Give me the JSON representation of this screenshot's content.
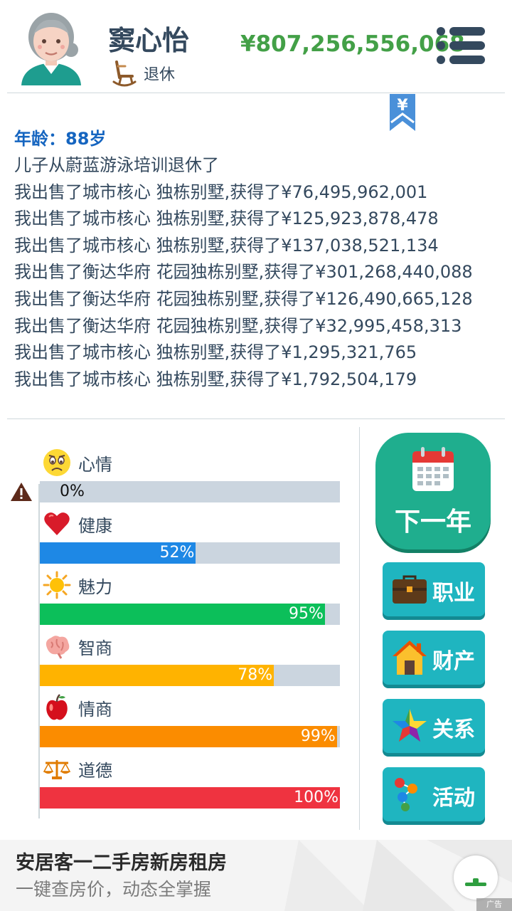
{
  "header": {
    "player_name": "窦心怡",
    "status": "退休",
    "money": "¥807,256,556,068"
  },
  "bookmark": {
    "symbol": "¥"
  },
  "log": {
    "age": "年龄：88岁",
    "lines": [
      "儿子从蔚蓝游泳培训退休了",
      "我出售了城市核心 独栋别墅,获得了¥76,495,962,001",
      "我出售了城市核心 独栋别墅,获得了¥125,923,878,478",
      "我出售了城市核心 独栋别墅,获得了¥137,038,521,134",
      "我出售了衡达华府 花园独栋别墅,获得了¥301,268,440,088",
      "我出售了衡达华府 花园独栋别墅,获得了¥126,490,665,128",
      "我出售了衡达华府 花园独栋别墅,获得了¥32,995,458,313",
      "我出售了城市核心 独栋别墅,获得了¥1,295,321,765",
      "我出售了城市核心 独栋别墅,获得了¥1,792,504,179"
    ]
  },
  "stats": [
    {
      "label": "心情",
      "value_text": "0%",
      "value": 0,
      "color": "#1e88e5",
      "icon": "sad-face-icon"
    },
    {
      "label": "健康",
      "value_text": "52%",
      "value": 52,
      "color": "#1e88e5",
      "icon": "heart-icon"
    },
    {
      "label": "魅力",
      "value_text": "95%",
      "value": 95,
      "color": "#0cbf5a",
      "icon": "sun-icon"
    },
    {
      "label": "智商",
      "value_text": "78%",
      "value": 78,
      "color": "#ffb300",
      "icon": "brain-icon"
    },
    {
      "label": "情商",
      "value_text": "99%",
      "value": 99,
      "color": "#fb8c00",
      "icon": "apple-icon"
    },
    {
      "label": "道德",
      "value_text": "100%",
      "value": 100,
      "color": "#ef3340",
      "icon": "scales-icon"
    }
  ],
  "actions": {
    "next_year": "下一年",
    "career": "职业",
    "assets": "财产",
    "relations": "关系",
    "activities": "活动"
  },
  "ad": {
    "title": "安居客一二手房新房租房",
    "subtitle": "一键查房价，动态全掌握",
    "tag": "广告"
  },
  "colors": {
    "money": "#43a047",
    "age": "#1565c0",
    "next_year_button": "#1fae8e",
    "side_button": "#1fb5c0",
    "bar_track": "#cbd5df"
  }
}
